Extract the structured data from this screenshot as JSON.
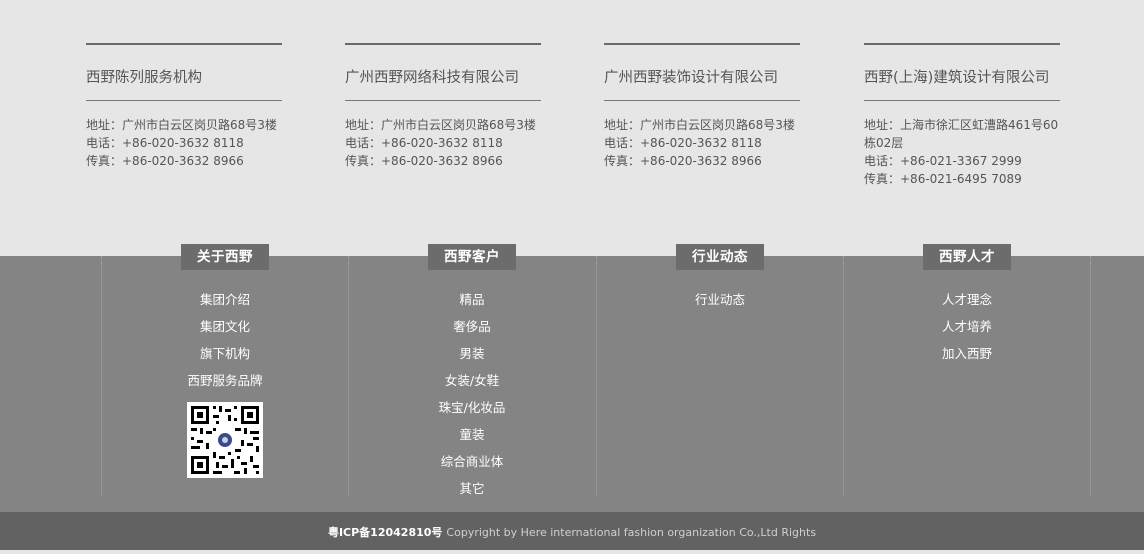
{
  "companies": [
    {
      "name": "西野陈列服务机构",
      "lines": [
        "地址：广州市白云区岗贝路68号3楼",
        "电话：+86-020-3632 8118",
        "传真：+86-020-3632 8966"
      ]
    },
    {
      "name": "广州西野网络科技有限公司",
      "lines": [
        "地址：广州市白云区岗贝路68号3楼",
        "电话：+86-020-3632 8118",
        "传真：+86-020-3632 8966"
      ]
    },
    {
      "name": "广州西野装饰设计有限公司",
      "lines": [
        "地址：广州市白云区岗贝路68号3楼",
        "电话：+86-020-3632 8118",
        "传真：+86-020-3632 8966"
      ]
    },
    {
      "name": "西野(上海)建筑设计有限公司",
      "lines": [
        "地址：上海市徐汇区虹漕路461号60栋02层",
        "电话：+86-021-3367 2999",
        "传真：+86-021-6495 7089"
      ]
    }
  ],
  "nav": [
    {
      "title": "关于西野",
      "items": [
        "集团介绍",
        "集团文化",
        "旗下机构",
        "西野服务品牌"
      ]
    },
    {
      "title": "西野客户",
      "items": [
        "精品",
        "奢侈品",
        "男装",
        "女装/女鞋",
        "珠宝/化妆品",
        "童装",
        "综合商业体",
        "其它"
      ]
    },
    {
      "title": "行业动态",
      "items": [
        "行业动态"
      ]
    },
    {
      "title": "西野人才",
      "items": [
        "人才理念",
        "人才培养",
        "加入西野"
      ]
    }
  ],
  "footer": {
    "icp": "粤ICP备12042810号",
    "copyright": "Copyright by Here international fashion organization Co.,Ltd Rights"
  }
}
